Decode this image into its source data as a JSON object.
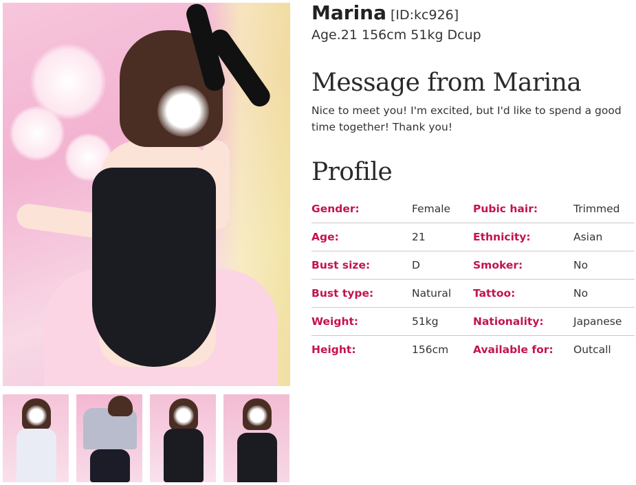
{
  "profile": {
    "name": "Marina",
    "id_label": "[ID:kc926]",
    "stats": "Age.21 156cm 51kg Dcup"
  },
  "message": {
    "title": "Message from Marina",
    "text": "Nice to meet you! I'm excited, but I'd like to spend a good time together! Thank you!"
  },
  "profile_section": {
    "title": "Profile",
    "rows": [
      {
        "label_left": "Gender:",
        "value_left": "Female",
        "label_right": "Pubic hair:",
        "value_right": "Trimmed"
      },
      {
        "label_left": "Age:",
        "value_left": "21",
        "label_right": "Ethnicity:",
        "value_right": "Asian"
      },
      {
        "label_left": "Bust size:",
        "value_left": "D",
        "label_right": "Smoker:",
        "value_right": "No"
      },
      {
        "label_left": "Bust type:",
        "value_left": "Natural",
        "label_right": "Tattoo:",
        "value_right": "No"
      },
      {
        "label_left": "Weight:",
        "value_left": "51kg",
        "label_right": "Nationality:",
        "value_right": "Japanese"
      },
      {
        "label_left": "Height:",
        "value_left": "156cm",
        "label_right": "Available for:",
        "value_right": "Outcall"
      }
    ]
  },
  "gallery": {
    "thumbnails": [
      {
        "outfit": "sailor-uniform"
      },
      {
        "outfit": "sailor-uniform-back"
      },
      {
        "outfit": "bunny-suit"
      },
      {
        "outfit": "bunny-suit-kneeling"
      }
    ]
  },
  "colors": {
    "label_accent": "#c4134e",
    "divider": "#c8c8c8",
    "text": "#333333"
  }
}
